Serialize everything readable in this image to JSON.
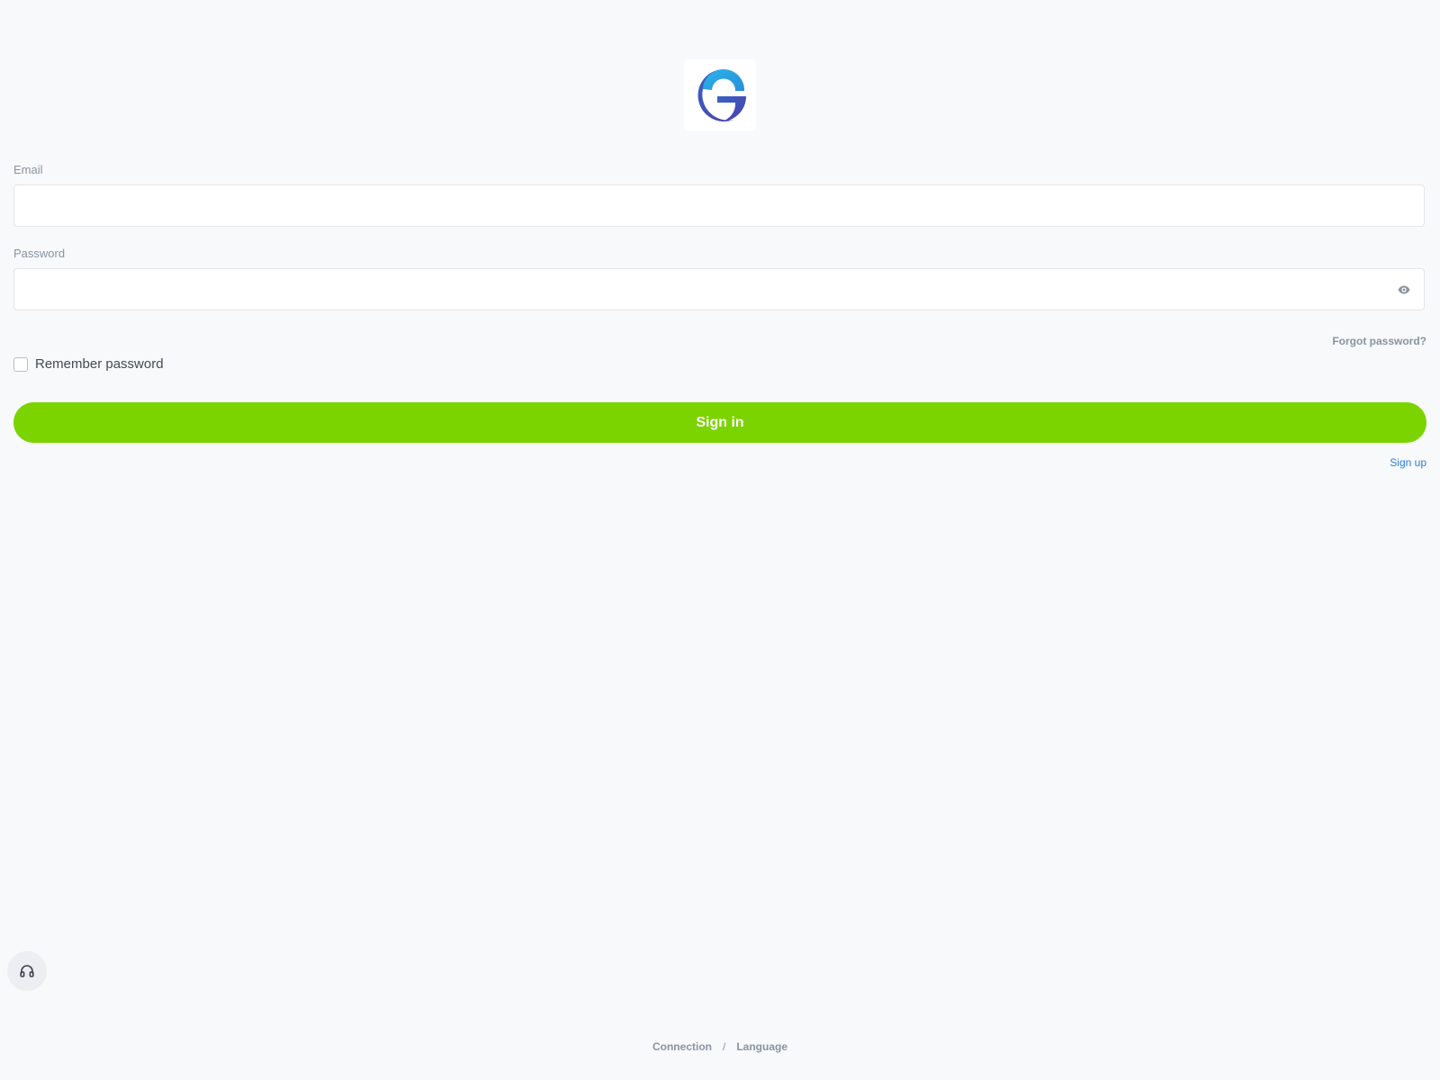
{
  "logo": {
    "icon": "brand-g-logo",
    "colors": [
      "#2bb5ea",
      "#3d4fb3"
    ]
  },
  "form": {
    "email_label": "Email",
    "email_value": "",
    "password_label": "Password",
    "password_value": "",
    "forgot_password": "Forgot password?",
    "remember_label": "Remember password",
    "remember_checked": false,
    "signin_label": "Sign in",
    "signup_label": "Sign up"
  },
  "support": {
    "icon": "headset-icon"
  },
  "footer": {
    "connection": "Connection",
    "separator": "/",
    "language": "Language"
  },
  "colors": {
    "accent": "#7bd300",
    "link": "#2a7de1",
    "muted": "#8a93a0",
    "background": "#f7f9fb"
  }
}
